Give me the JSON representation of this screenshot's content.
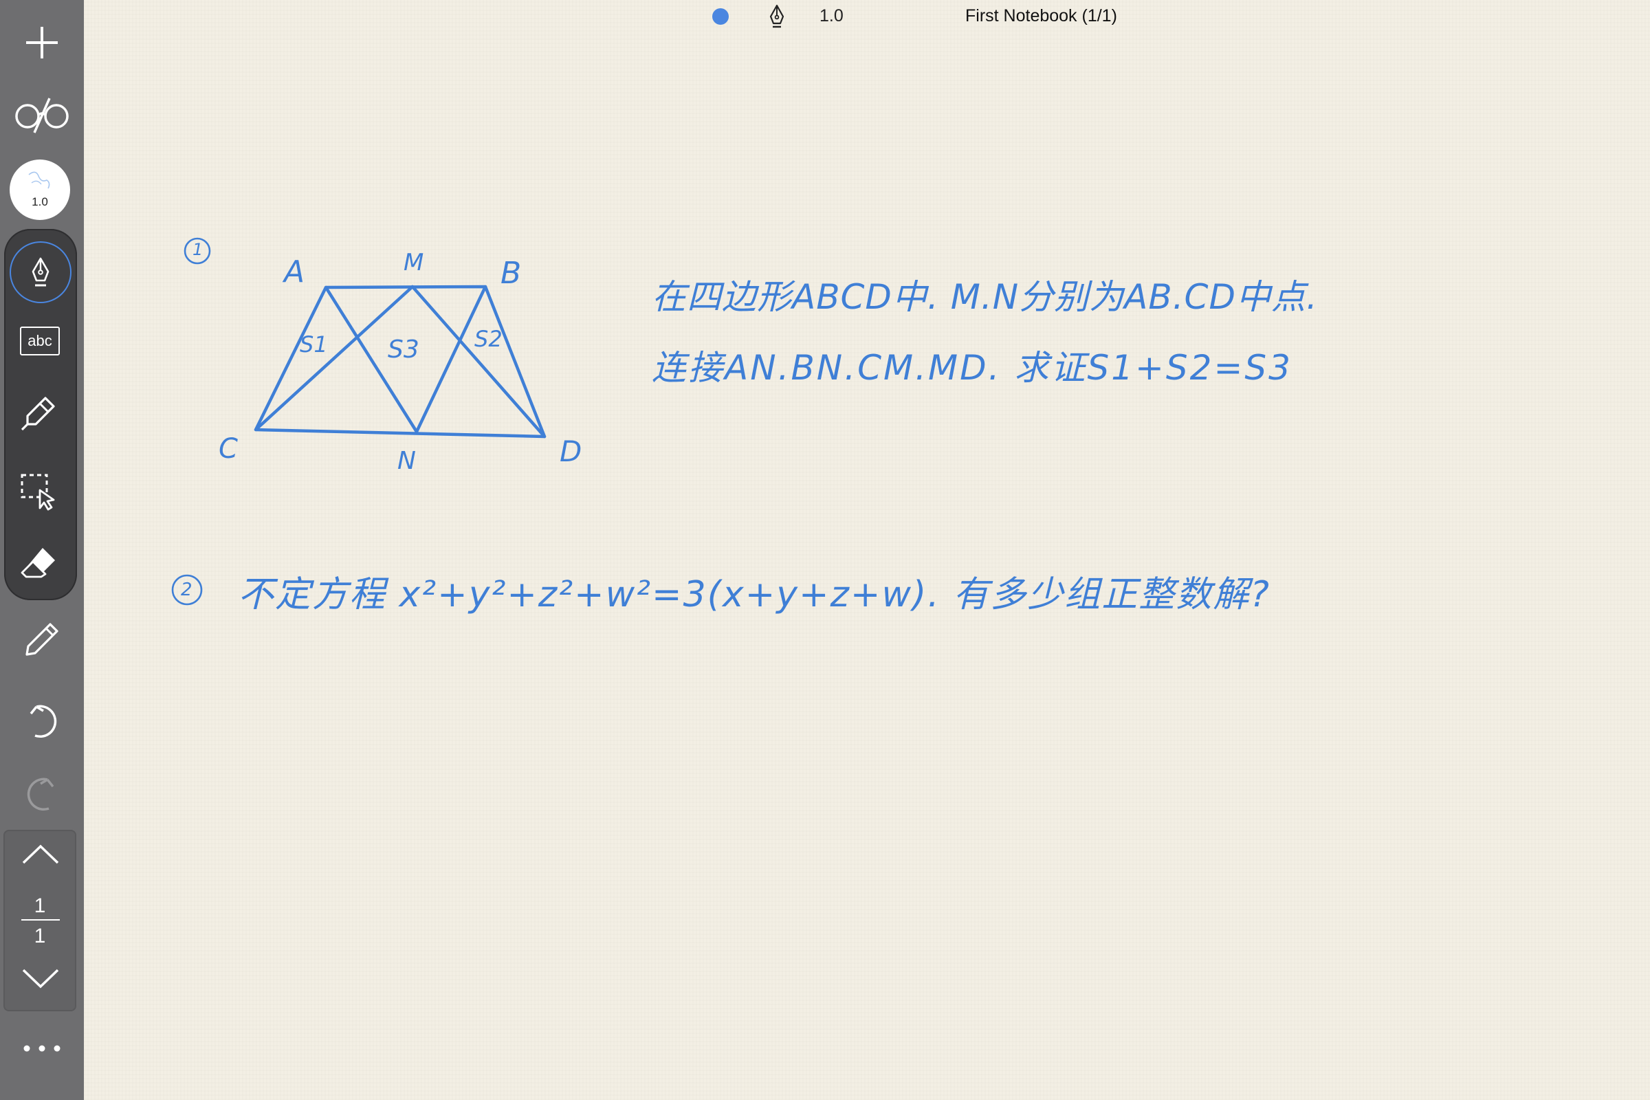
{
  "header": {
    "ink_color": "#4a86e0",
    "tool_icon": "fountain-pen-icon",
    "stroke_size": "1.0",
    "notebook_title": "First Notebook (1/1)"
  },
  "sidebar": {
    "stroke_preview_value": "1.0",
    "text_tool_label": "abc",
    "tools": [
      "add-icon",
      "reading-glasses-icon",
      "stroke-width-icon",
      "fountain-pen-icon",
      "text-tool-icon",
      "highlighter-icon",
      "lasso-select-icon",
      "eraser-icon",
      "pencil-icon",
      "undo-icon",
      "redo-icon"
    ],
    "pager": {
      "current": "1",
      "total": "1"
    },
    "more_icon": "ellipsis-icon"
  },
  "note": {
    "problem1": {
      "number": "1",
      "labels": {
        "A": "A",
        "M": "M",
        "B": "B",
        "C": "C",
        "N": "N",
        "D": "D",
        "s1": "S1",
        "s3": "S3",
        "s2": "S2"
      },
      "line1": "在四边形ABCD中. M.N分别为AB.CD中点.",
      "line2": "连接AN.BN.CM.MD. 求证S1+S2=S3"
    },
    "problem2": {
      "number": "2",
      "text": "不定方程 x²+y²+z²+w²=3(x+y+z+w). 有多少组正整数解?"
    }
  }
}
